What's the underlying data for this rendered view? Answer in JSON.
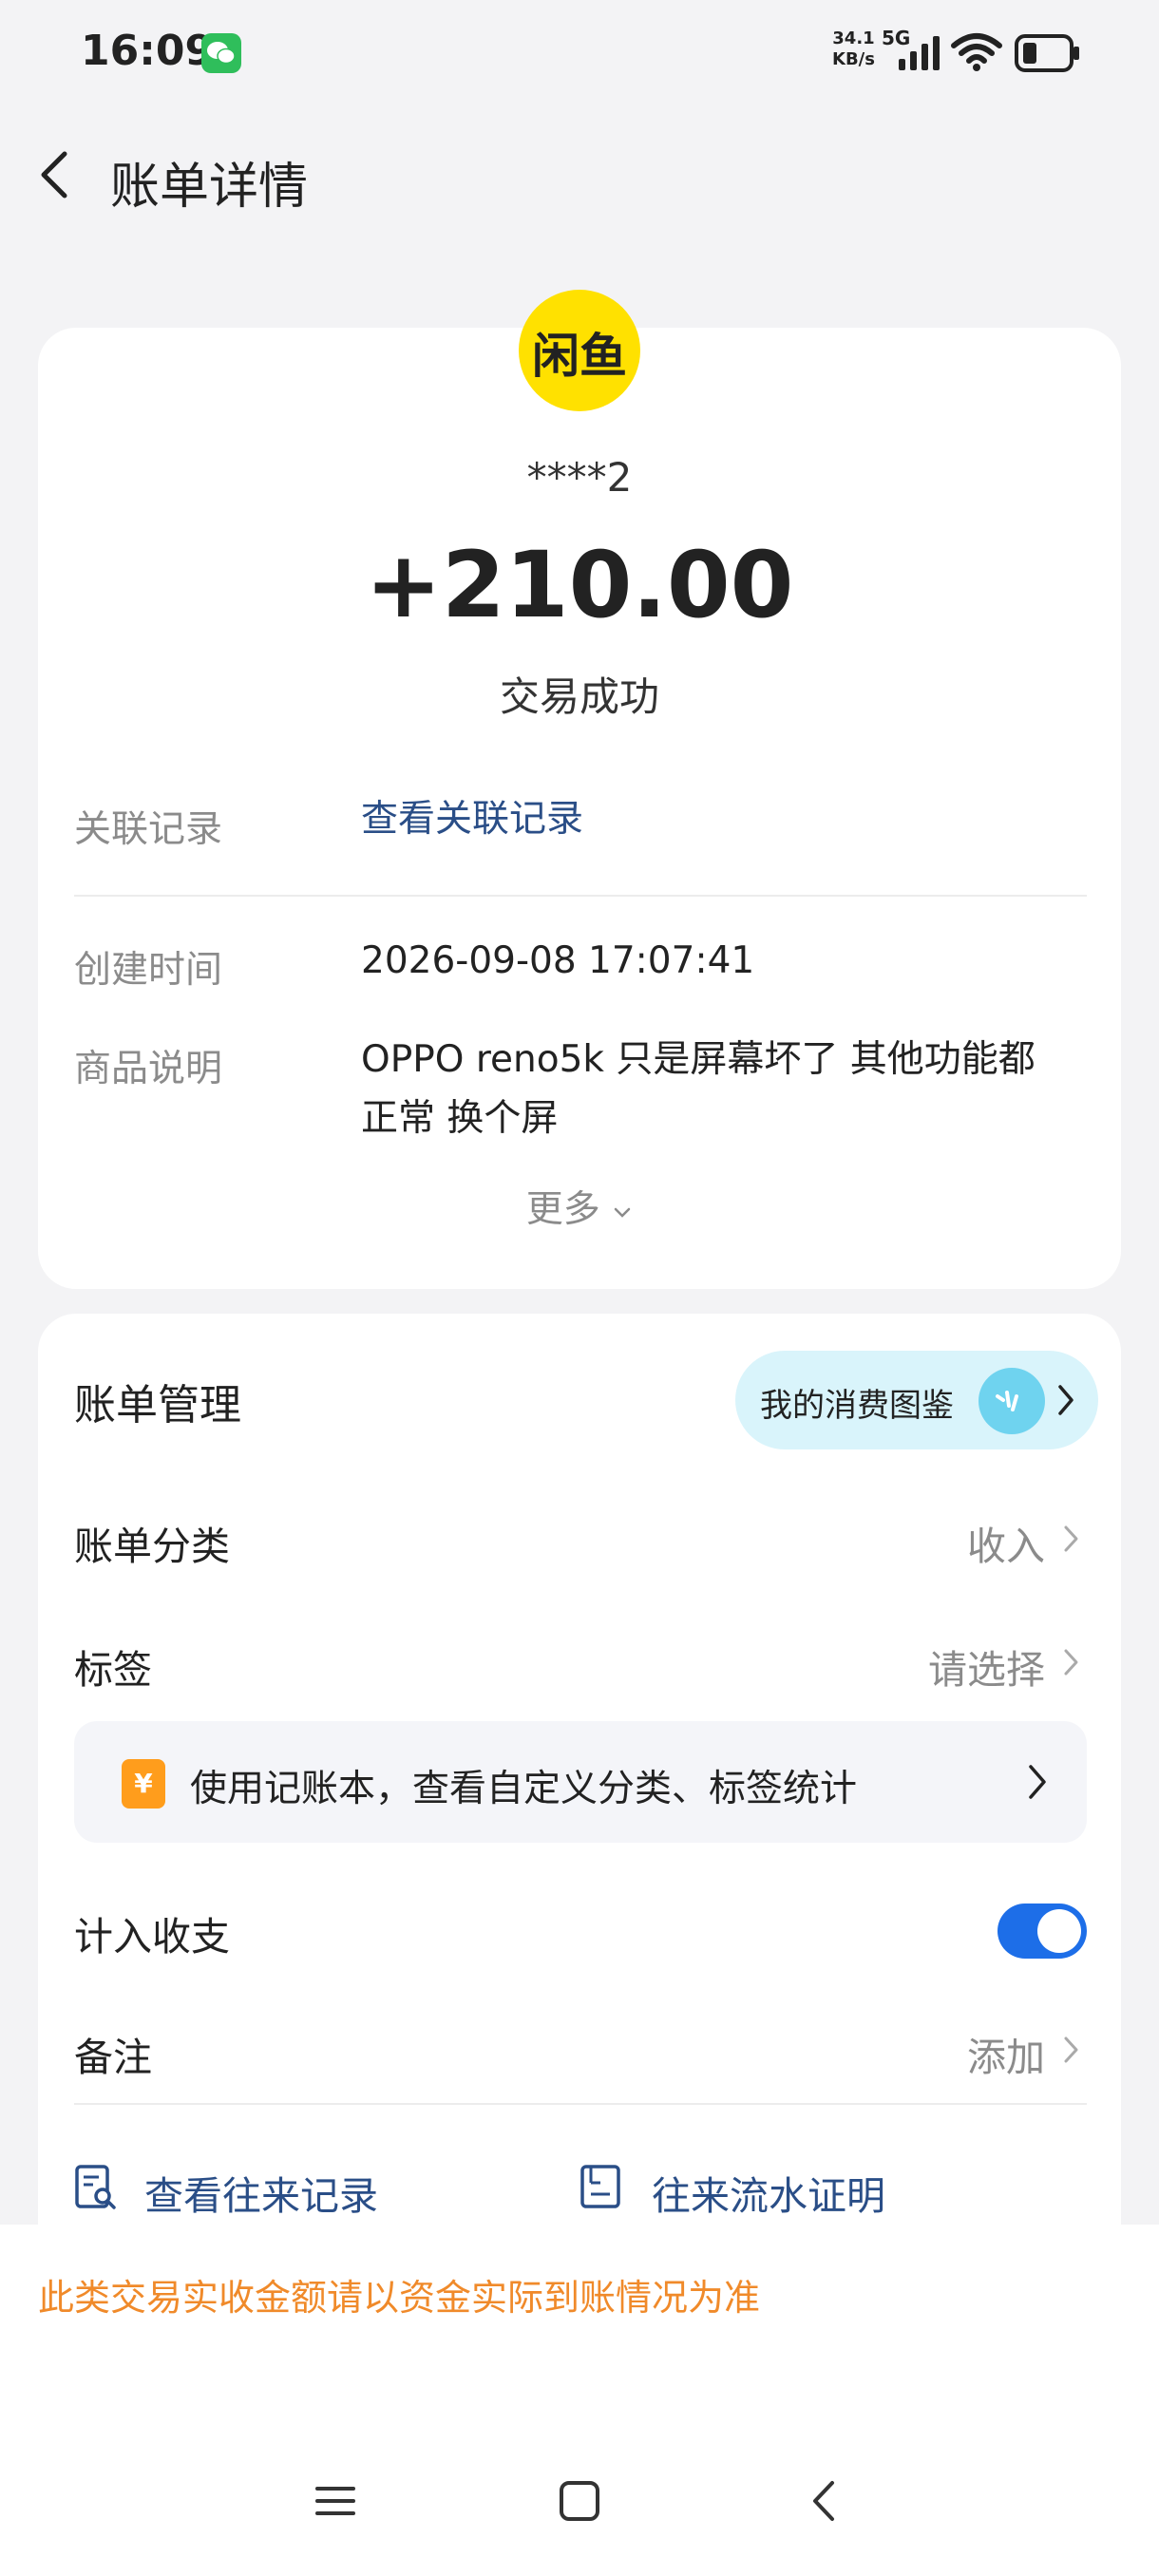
{
  "status_bar": {
    "time": "16:09",
    "net_speed_value": "34.1",
    "net_speed_unit": "KB/s",
    "network": "5G",
    "app_notification_icon": "wechat-icon",
    "icons": [
      "signal-icon",
      "wifi-icon",
      "battery-icon"
    ]
  },
  "header": {
    "title": "账单详情",
    "back_icon": "chevron-left-icon"
  },
  "summary": {
    "logo_text": "闲鱼",
    "counterparty": "****2",
    "amount": "+210.00",
    "status": "交易成功"
  },
  "details": {
    "related_label": "关联记录",
    "related_link": "查看关联记录",
    "created_label": "创建时间",
    "created_value": "2026-09-08 17:07:41",
    "product_label": "商品说明",
    "product_line1": "OPPO reno5k 只是屏幕坏了 其他功能都",
    "product_line2": "正常 换个屏",
    "more_label": "更多"
  },
  "management": {
    "title": "账单管理",
    "gallery_label": "我的消费图鉴",
    "category_label": "账单分类",
    "category_value": "收入",
    "tag_label": "标签",
    "tag_value": "请选择",
    "promo_text": "使用记账本，查看自定义分类、标签统计",
    "include_label": "计入收支",
    "include_on": true,
    "note_label": "备注",
    "note_value": "添加",
    "history_link": "查看往来记录",
    "statement_link": "往来流水证明"
  },
  "notice": "此类交易实收金额请以资金实际到账情况为准",
  "colors": {
    "accent_blue": "#1d6ee8",
    "link_blue": "#2a4e87",
    "notice_orange": "#f08a2a",
    "logo_yellow": "#ffe100"
  },
  "nav_bar": [
    "menu-icon",
    "home-icon",
    "back-icon"
  ]
}
